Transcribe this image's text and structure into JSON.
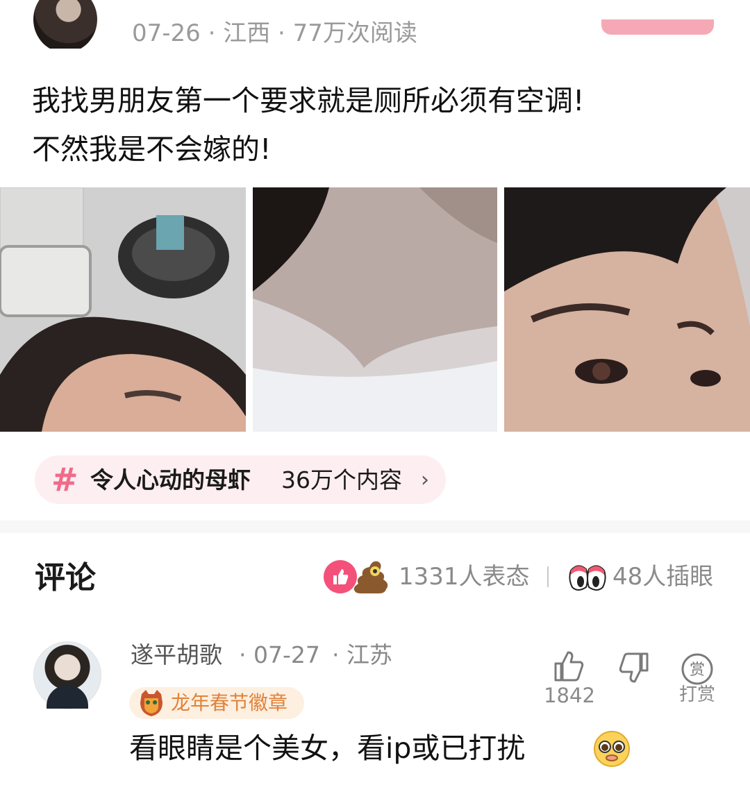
{
  "post": {
    "meta": "07-26 · 江西 · 77万次阅读",
    "text_lines": [
      "我找男朋友第一个要求就是厕所必须有空调!",
      "不然我是不会嫁的!"
    ]
  },
  "topic": {
    "hash": "#",
    "title": "令人心动的母虾",
    "count": "36万个内容",
    "chevron": "›"
  },
  "comments_section": {
    "title": "评论",
    "reactions": "1331人表态",
    "eyes": "48人插眼"
  },
  "comment": {
    "author": "遂平胡歌",
    "date": "· 07-27",
    "location": "· 江苏",
    "badge": "龙年春节徽章",
    "text": "看眼睛是个美女，看ip或已打扰",
    "like_count": "1842",
    "tip_label": "打赏",
    "tip_glyph": "赏"
  },
  "colors": {
    "accent_pink": "#f3517a",
    "badge_orange": "#e0823a"
  }
}
